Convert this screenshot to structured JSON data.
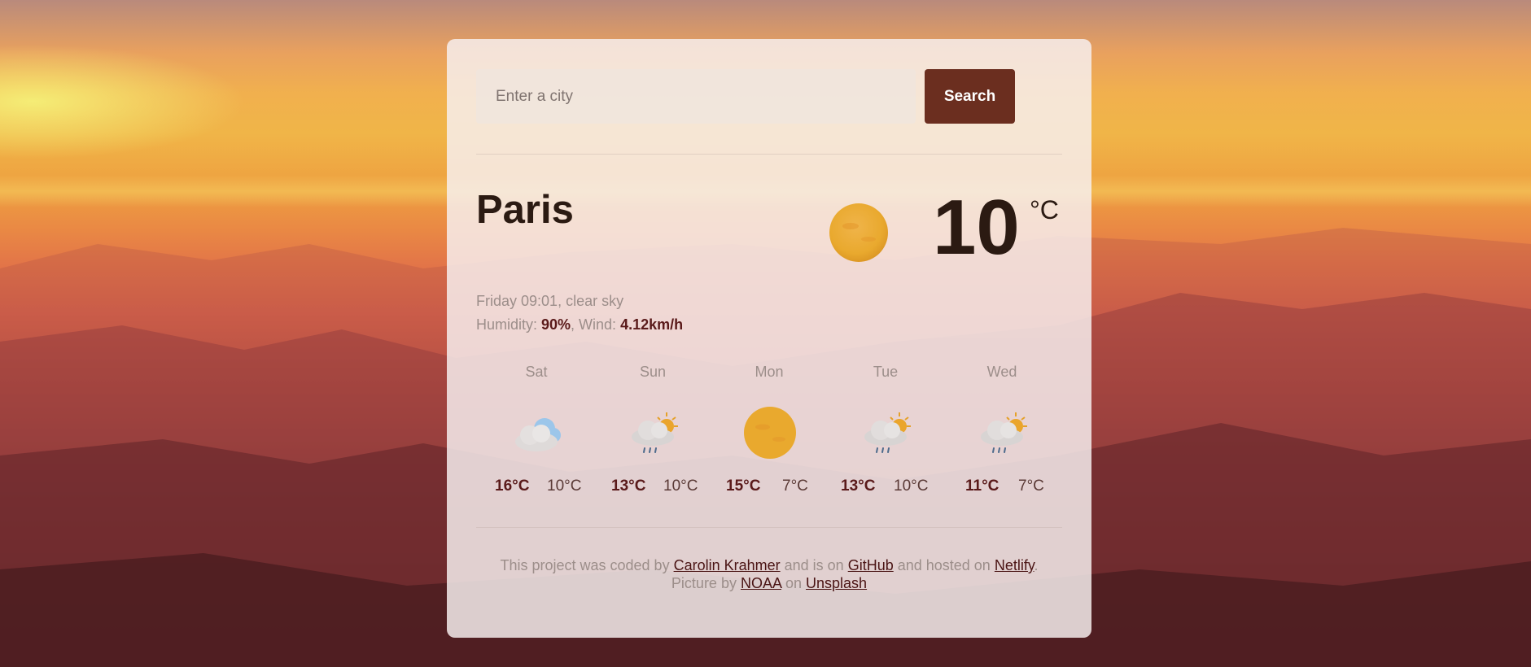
{
  "colors": {
    "accent": "#6b2e1f",
    "highlight": "#5a1a1a",
    "text_dark": "#2b1a12",
    "muted": "#9c8e8a",
    "sun": "#efb32a"
  },
  "search": {
    "placeholder": "Enter a city",
    "button_label": "Search"
  },
  "current": {
    "city": "Paris",
    "datetime": "Friday 09:01",
    "separator": ", ",
    "description": "clear sky",
    "humidity_label": "Humidity: ",
    "humidity_value": "90%",
    "wind_label": ", Wind: ",
    "wind_value": "4.12km/h",
    "temperature": "10",
    "unit": "°C",
    "icon": "sun-icon"
  },
  "forecast": [
    {
      "day": "Sat",
      "max": "16°C",
      "min": "10°C",
      "icon": "cloud-icon"
    },
    {
      "day": "Sun",
      "max": "13°C",
      "min": "10°C",
      "icon": "rain-sun-icon"
    },
    {
      "day": "Mon",
      "max": "15°C",
      "min": "7°C",
      "icon": "sun-icon"
    },
    {
      "day": "Tue",
      "max": "13°C",
      "min": "10°C",
      "icon": "rain-sun-icon"
    },
    {
      "day": "Wed",
      "max": "11°C",
      "min": "7°C",
      "icon": "rain-sun-icon"
    }
  ],
  "footer": {
    "line1_prefix": "This project was coded by ",
    "author": "Carolin Krahmer",
    "mid1": " and is on ",
    "github": "GitHub",
    "mid2": " and hosted on ",
    "netlify": "Netlify",
    "end": ".",
    "line2_prefix": "Picture by ",
    "noaa": "NOAA",
    "mid3": " on ",
    "unsplash": "Unsplash"
  }
}
